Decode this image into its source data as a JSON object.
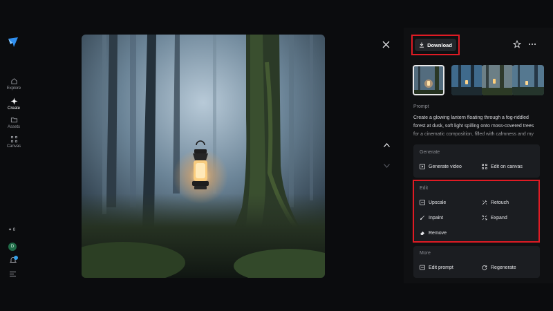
{
  "sidebar": {
    "items": [
      {
        "label": "Explore",
        "icon": "home-icon"
      },
      {
        "label": "Create",
        "icon": "sparkle-icon"
      },
      {
        "label": "Assets",
        "icon": "folder-icon"
      },
      {
        "label": "Canvas",
        "icon": "canvas-icon"
      }
    ],
    "credits": "0",
    "avatar_initial": "D"
  },
  "toolbar": {
    "download_label": "Download"
  },
  "prompt": {
    "label": "Prompt",
    "text": "Create a glowing lantern floating through a fog-riddled forest at dusk, soft light spilling onto moss-covered trees for a cinematic composition, filled with calmness and my"
  },
  "generate": {
    "title": "Generate",
    "actions": [
      "Generate video",
      "Edit on canvas"
    ]
  },
  "edit": {
    "title": "Edit",
    "actions": [
      "Upscale",
      "Retouch",
      "Inpaint",
      "Expand",
      "Remove"
    ]
  },
  "more": {
    "title": "More",
    "actions": [
      "Edit prompt",
      "Regenerate"
    ]
  },
  "colors": {
    "accent_highlight": "#e01b24",
    "background": "#0b0c0e",
    "card": "#1b1d21",
    "avatar": "#1f6b47",
    "notification": "#35a0e8"
  }
}
